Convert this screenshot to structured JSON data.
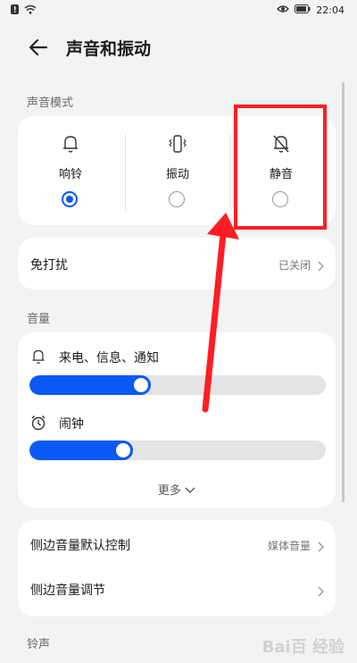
{
  "status_bar": {
    "time": "22:04",
    "left_icons": [
      "notification-icon",
      "wifi-icon"
    ],
    "right_icons": [
      "eye-icon",
      "battery-icon"
    ]
  },
  "header": {
    "title": "声音和振动"
  },
  "sound_mode": {
    "label": "声音模式",
    "options": [
      {
        "label": "响铃",
        "icon": "bell-icon",
        "selected": true
      },
      {
        "label": "振动",
        "icon": "vibrate-icon",
        "selected": false
      },
      {
        "label": "静音",
        "icon": "bell-off-icon",
        "selected": false
      }
    ]
  },
  "dnd": {
    "label": "免打扰",
    "value": "已关闭"
  },
  "volume": {
    "label": "音量",
    "items": [
      {
        "label": "来电、信息、通知",
        "icon": "bell-icon",
        "level": 0.41
      },
      {
        "label": "闹钟",
        "icon": "alarm-clock-icon",
        "level": 0.35
      }
    ],
    "more": "更多"
  },
  "side_keys": [
    {
      "label": "侧边音量默认控制",
      "value": "媒体音量"
    },
    {
      "label": "侧边音量调节",
      "value": ""
    }
  ],
  "ringtone": {
    "label": "铃声"
  },
  "annotation": {
    "highlight_color": "#ff1d25"
  },
  "watermark": "Bai百 经验"
}
